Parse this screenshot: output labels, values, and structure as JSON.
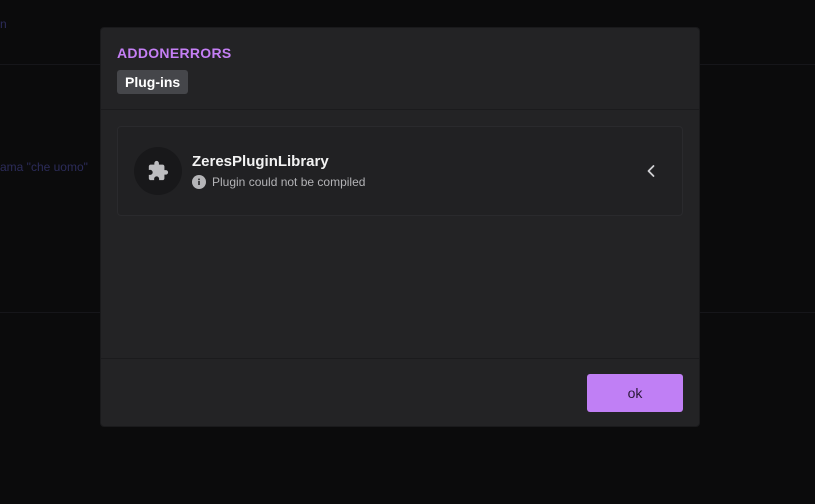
{
  "background": {
    "partial_text_1": "n",
    "partial_text_2": "ama \"che uomo\""
  },
  "modal": {
    "title": "ADDONERRORS",
    "tab_label": "Plug-ins",
    "errors": [
      {
        "name": "ZeresPluginLibrary",
        "message": "Plugin could not be compiled",
        "icon": "puzzle-piece-icon"
      }
    ],
    "ok_label": "ok"
  },
  "colors": {
    "accent": "#c07ff5",
    "title": "#c57ff5",
    "modal_bg": "#232325",
    "page_bg": "#0b0b0c"
  }
}
